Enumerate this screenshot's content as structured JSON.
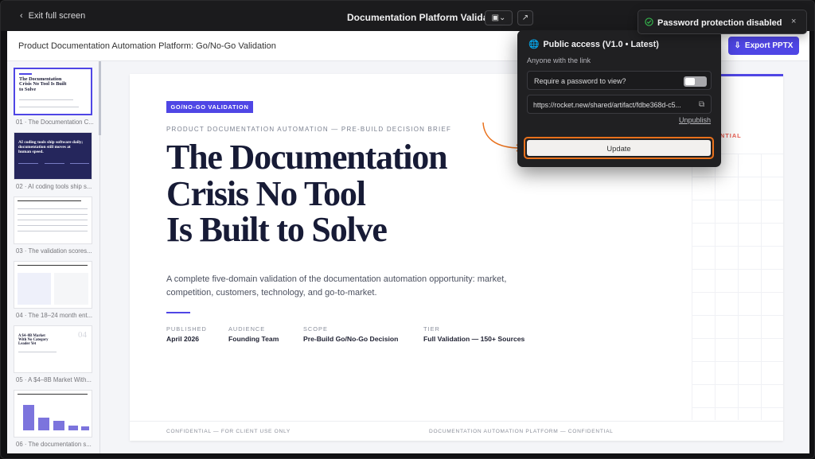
{
  "topbar": {
    "exit_label": "Exit full screen",
    "title": "Documentation Platform Validation"
  },
  "header": {
    "doc_title": "Product Documentation Automation Platform: Go/No-Go Validation",
    "export_label": "Export PPTX"
  },
  "sidebar": {
    "items": [
      {
        "label": "01 · The Documentation C...",
        "thumb_title": "The Documentation Crisis No Tool Is Built to Solve"
      },
      {
        "label": "02 · AI coding tools ship s...",
        "thumb_title": "AI coding tools ship software daily; documentation still moves at human speed."
      },
      {
        "label": "03 · The validation scores..."
      },
      {
        "label": "04 · The 18–24 month ent..."
      },
      {
        "label": "05 · A $4–8B Market With...",
        "thumb_title": "A $4–8B Market With No Category Leader Yet",
        "thumb_num": "04"
      },
      {
        "label": "06 · The documentation s..."
      }
    ]
  },
  "slide": {
    "badge": "GO/NO-GO VALIDATION",
    "kicker": "PRODUCT DOCUMENTATION AUTOMATION — PRE-BUILD DECISION BRIEF",
    "headline_1": "The Documentation",
    "headline_2": "Crisis No Tool",
    "headline_3": "Is Built to Solve",
    "subtitle": "A complete five-domain validation of the documentation automation opportunity: market, competition, customers, technology, and go-to-market.",
    "confidential_fragment": "ENTIAL",
    "meta": [
      {
        "key": "PUBLISHED",
        "value": "April 2026"
      },
      {
        "key": "AUDIENCE",
        "value": "Founding Team"
      },
      {
        "key": "SCOPE",
        "value": "Pre-Build Go/No-Go Decision"
      },
      {
        "key": "TIER",
        "value": "Full Validation — 150+ Sources"
      }
    ],
    "footer_left": "CONFIDENTIAL — FOR CLIENT USE ONLY",
    "footer_right": "DOCUMENTATION AUTOMATION PLATFORM — CONFIDENTIAL"
  },
  "popover": {
    "title": "Public access (V1.0 • Latest)",
    "subtitle": "Anyone with the link",
    "password_label": "Require a password to view?",
    "password_toggle_on": false,
    "url": "https://rocket.new/shared/artifact/fdbe368d-c5...",
    "unpublish_label": "Unpublish",
    "update_label": "Update"
  },
  "toast": {
    "message": "Password protection disabled"
  },
  "colors": {
    "accent": "#4f46e5",
    "highlight": "#e9711c",
    "success": "#35b84d"
  }
}
